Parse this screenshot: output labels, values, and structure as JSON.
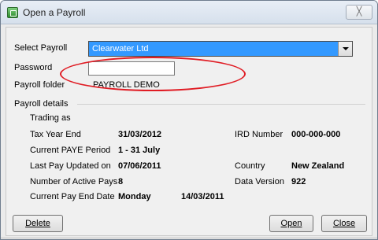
{
  "window": {
    "title": "Open a Payroll",
    "close_label": "╳"
  },
  "form": {
    "select_payroll_label": "Select Payroll",
    "select_payroll_value": "Clearwater Ltd",
    "password_label": "Password",
    "password_value": "",
    "payroll_folder_label": "Payroll folder",
    "payroll_folder_value": "PAYROLL DEMO"
  },
  "details": {
    "section_label": "Payroll details",
    "trading_as_label": "Trading as",
    "trading_as_value": "",
    "tax_year_end_label": "Tax Year End",
    "tax_year_end_value": "31/03/2012",
    "ird_number_label": "IRD Number",
    "ird_number_value": "000-000-000",
    "current_paye_label": "Current PAYE Period",
    "current_paye_value": "1 - 31 July",
    "last_pay_label": "Last Pay Updated on",
    "last_pay_value": "07/06/2011",
    "country_label": "Country",
    "country_value": "New Zealand",
    "active_pays_label": "Number of Active Pays",
    "active_pays_value": "8",
    "data_version_label": "Data Version",
    "data_version_value": "922",
    "pay_end_label": "Current Pay End Date",
    "pay_end_day": "Monday",
    "pay_end_date": "14/03/2011"
  },
  "buttons": {
    "delete": "Delete",
    "open": "Open",
    "close": "Close"
  },
  "colors": {
    "selection": "#3399ff",
    "annotation": "#e01c24"
  }
}
